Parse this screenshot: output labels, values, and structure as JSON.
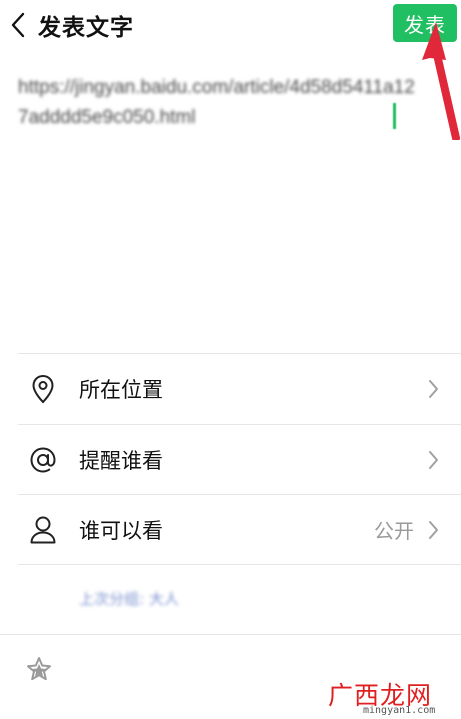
{
  "header": {
    "title": "发表文字",
    "publish_label": "发表"
  },
  "composer": {
    "text": "https://jingyan.baidu.com/article/4d58d5411a127adddd5e9c050.html"
  },
  "options": [
    {
      "label": "所在位置",
      "value": ""
    },
    {
      "label": "提醒谁看",
      "value": ""
    },
    {
      "label": "谁可以看",
      "value": "公开"
    }
  ],
  "note": "上次分组: 大人",
  "watermark": {
    "logo": "广西龙网",
    "url": "mingyan1.com"
  },
  "colors": {
    "accent": "#1fbf62",
    "arrow": "#e0283a",
    "watermark": "#e02020"
  }
}
